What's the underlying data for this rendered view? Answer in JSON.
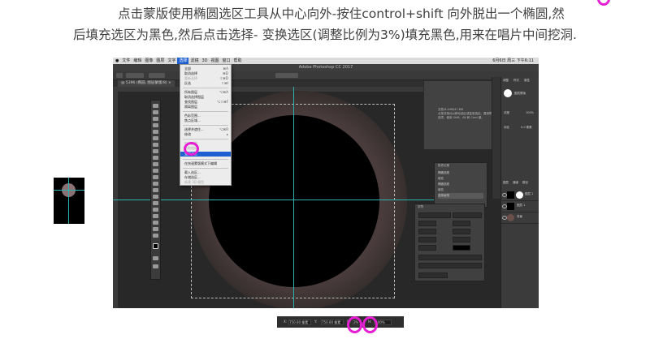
{
  "caption": {
    "line1": "点击蒙版使用椭圆选区工具从中心向外-按住control+shift 向外脱出一个椭圆,然",
    "line2": "后填充选区为黑色,然后点击选择- 变换选区(调整比例为3%)填充黑色,用来在唱片中间挖洞."
  },
  "menubar": {
    "apple": "",
    "items": [
      "文件",
      "编辑",
      "图像",
      "图层",
      "文字",
      "选择",
      "滤镜",
      "3D",
      "视图",
      "窗口",
      "帮助"
    ],
    "active": "选择",
    "clock": "6月6日 周三 下午6:11"
  },
  "window_title": "Adobe Photoshop CC 2017",
  "doc_tab": "@ 5396 (椭圆, 图层蒙版/8) ×",
  "select_menu": {
    "items": [
      {
        "label": "全部",
        "shortcut": "⌘A"
      },
      {
        "label": "取消选择",
        "shortcut": "⌘D"
      },
      {
        "label": "重新选择",
        "shortcut": "⇧⌘D"
      },
      {
        "label": "反选",
        "shortcut": "⇧⌘I"
      },
      {
        "label": "所有图层",
        "shortcut": "⌥⌘A"
      },
      {
        "label": "取消选择图层",
        "shortcut": ""
      },
      {
        "label": "查找图层",
        "shortcut": "⌥⇧⌘F"
      },
      {
        "label": "隔离图层",
        "shortcut": ""
      },
      {
        "label": "色彩范围...",
        "shortcut": ""
      },
      {
        "label": "焦点区域...",
        "shortcut": ""
      },
      {
        "label": "选择并遮住...",
        "shortcut": "⌥⌘R"
      },
      {
        "label": "修改",
        "shortcut": "▸"
      },
      {
        "label": "扩大选取",
        "shortcut": ""
      },
      {
        "label": "选取相似",
        "shortcut": ""
      },
      {
        "label": "变换选区",
        "shortcut": ""
      },
      {
        "label": "在快速蒙版模式下编辑",
        "shortcut": ""
      },
      {
        "label": "载入选区...",
        "shortcut": ""
      },
      {
        "label": "存储选区...",
        "shortcut": ""
      },
      {
        "label": "新建 3D 模型",
        "shortcut": ""
      }
    ],
    "highlighted": "变换选区"
  },
  "info_panel": {
    "text": "文档:6.44M/47.6M",
    "hint": "点按并拖动以移动选区或复制选区。要用附加选项，使用 Shift、Alt 和 Cmd 键。"
  },
  "layers": {
    "tabs": [
      "图层",
      "通道",
      "路径"
    ],
    "rows": [
      {
        "name": "图层 1"
      },
      {
        "name": "图层 1"
      },
      {
        "name": "背景"
      }
    ],
    "opacity_label": "不透明度: 100%",
    "fill_label": "填充: 100%"
  },
  "properties": {
    "tabs": [
      "调整",
      "样式",
      "属性"
    ],
    "mask_label": "图层蒙版",
    "density_label": "浓度",
    "density_value": "100%",
    "feather_label": "羽化",
    "feather_value": "0.0 像素"
  },
  "history": {
    "title": "历史记录",
    "rows": [
      "椭圆选框",
      "填充",
      "椭圆选框",
      "填充",
      "选择画笔"
    ],
    "selected": 4
  },
  "char_panel": {
    "tab": "字符"
  },
  "transform_bar": {
    "x_label": "X:",
    "x_value": "750.00 像素",
    "y_label": "Y:",
    "y_value": "750.00 像素",
    "w_label": "W:",
    "w_value": "3%",
    "h_label": "H:",
    "h_value": "3.00%"
  },
  "colors": {
    "accent_pink": "#e61fd4",
    "guide": "#2bb3ad",
    "menu_highlight": "#1d5fd0"
  }
}
